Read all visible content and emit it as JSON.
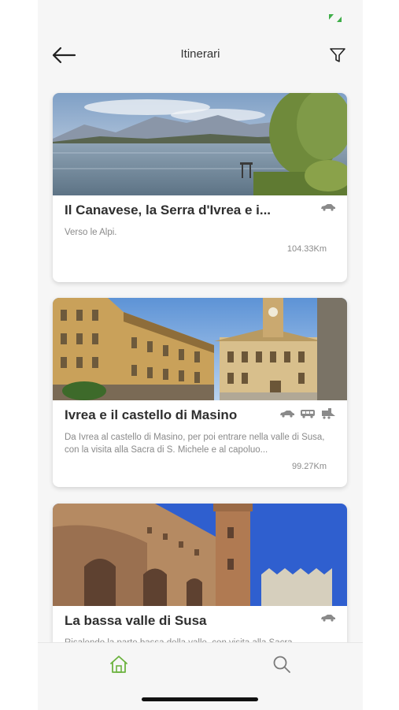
{
  "header": {
    "title": "Itinerari"
  },
  "itineraries": [
    {
      "title": "Il Canavese, la Serra d'Ivrea e i...",
      "description": "Verso le Alpi.",
      "distance": "104.33Km",
      "transport": [
        "car-icon"
      ]
    },
    {
      "title": "Ivrea e il castello di Masino",
      "description": "Da Ivrea al castello di Masino, per poi entrare nella valle di Susa, con la visita alla Sacra di S. Michele e al capoluo...",
      "distance": "99.27Km",
      "transport": [
        "car-icon",
        "bus-icon",
        "train-icon"
      ]
    },
    {
      "title": "La bassa valle di Susa",
      "description": "Risalendo la parte bassa della valle, con visita alla Sacra",
      "distance": "",
      "transport": [
        "car-icon"
      ]
    }
  ],
  "tabs": {
    "home": "home-icon",
    "search": "search-icon"
  },
  "colors": {
    "accent": "#6cb33f",
    "background": "#f6f6f6",
    "card": "#ffffff"
  }
}
